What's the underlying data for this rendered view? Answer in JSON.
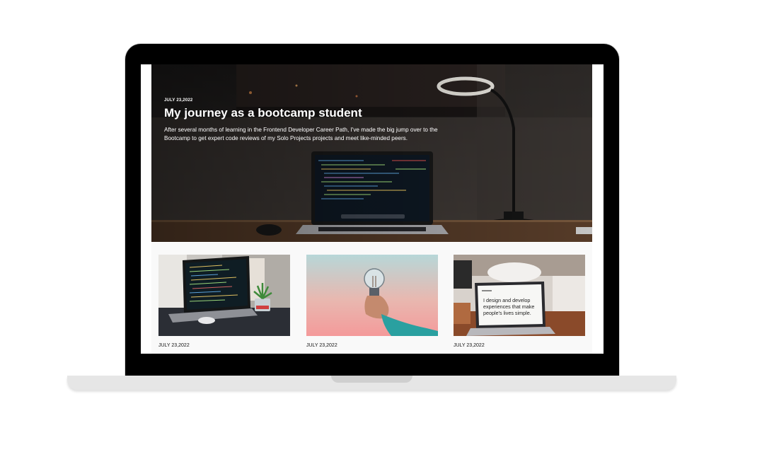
{
  "hero": {
    "date": "JULY 23,2022",
    "title": "My journey as a bootcamp student",
    "text": "After several months of learning in the Frontend Developer Career Path, I've made the big jump over to the Bootcamp to get expert code reviews of my Solo Projects projects and meet like-minded peers."
  },
  "posts": [
    {
      "date": "JULY 23,2022",
      "image": "laptop-code-desk-image"
    },
    {
      "date": "JULY 23,2022",
      "image": "lightbulb-hand-image"
    },
    {
      "date": "JULY 23,2022",
      "image": "laptop-design-message-image",
      "screen_text": [
        "I design and develop",
        "experiences that make",
        "people's lives simple."
      ]
    }
  ],
  "colors": {
    "laptop_frame": "#000000",
    "laptop_base": "#e6e6e6",
    "posts_background": "#f9f9f9",
    "hero_text": "#ffffff"
  }
}
